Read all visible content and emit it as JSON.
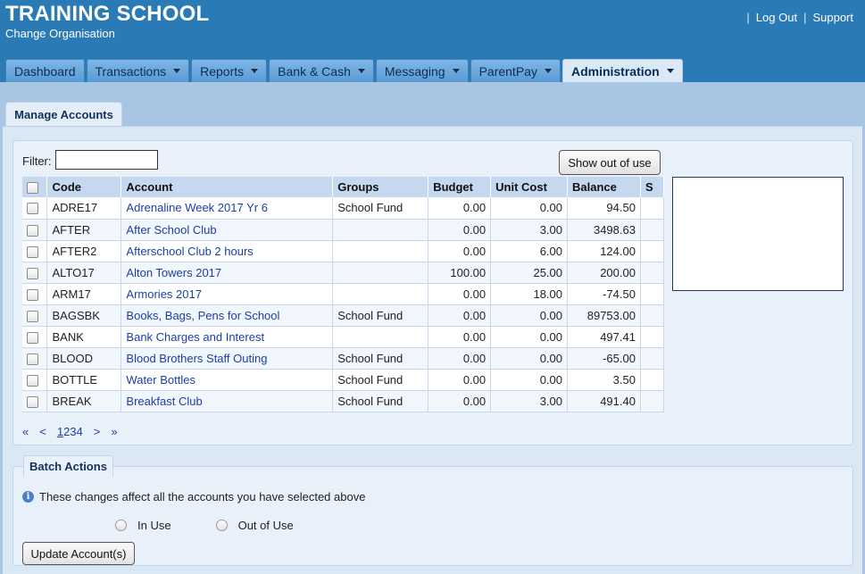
{
  "header": {
    "school_name": "TRAINING SCHOOL",
    "change_org": "Change Organisation",
    "sep": "|",
    "log_out": "Log Out",
    "support": "Support"
  },
  "nav": {
    "tabs": [
      {
        "label": "Dashboard"
      },
      {
        "label": "Transactions"
      },
      {
        "label": "Reports"
      },
      {
        "label": "Bank & Cash"
      },
      {
        "label": "Messaging"
      },
      {
        "label": "ParentPay"
      },
      {
        "label": "Administration"
      }
    ]
  },
  "page": {
    "subtab": "Manage Accounts",
    "filter_label": "Filter:",
    "filter_value": "",
    "show_out_of_use": "Show out of use"
  },
  "table": {
    "headers": {
      "code": "Code",
      "account": "Account",
      "groups": "Groups",
      "budget": "Budget",
      "unit_cost": "Unit Cost",
      "balance": "Balance",
      "s": "S"
    },
    "rows": [
      {
        "code": "ADRE17",
        "account": "Adrenaline Week 2017 Yr 6",
        "groups": "School Fund",
        "budget": "0.00",
        "unit_cost": "0.00",
        "balance": "94.50"
      },
      {
        "code": "AFTER",
        "account": "After School Club",
        "groups": "",
        "budget": "0.00",
        "unit_cost": "3.00",
        "balance": "3498.63"
      },
      {
        "code": "AFTER2",
        "account": "Afterschool Club 2 hours",
        "groups": "",
        "budget": "0.00",
        "unit_cost": "6.00",
        "balance": "124.00"
      },
      {
        "code": "ALTO17",
        "account": "Alton Towers 2017",
        "groups": "",
        "budget": "100.00",
        "unit_cost": "25.00",
        "balance": "200.00"
      },
      {
        "code": "ARM17",
        "account": "Armories 2017",
        "groups": "",
        "budget": "0.00",
        "unit_cost": "18.00",
        "balance": "-74.50"
      },
      {
        "code": "BAGSBK",
        "account": "Books, Bags, Pens for School",
        "groups": "School Fund",
        "budget": "0.00",
        "unit_cost": "0.00",
        "balance": "89753.00"
      },
      {
        "code": "BANK",
        "account": "Bank Charges and Interest",
        "groups": "",
        "budget": "0.00",
        "unit_cost": "0.00",
        "balance": "497.41"
      },
      {
        "code": "BLOOD",
        "account": "Blood Brothers Staff Outing",
        "groups": "School Fund",
        "budget": "0.00",
        "unit_cost": "0.00",
        "balance": "-65.00"
      },
      {
        "code": "BOTTLE",
        "account": "Water Bottles",
        "groups": "School Fund",
        "budget": "0.00",
        "unit_cost": "0.00",
        "balance": "3.50"
      },
      {
        "code": "BREAK",
        "account": "Breakfast Club",
        "groups": "School Fund",
        "budget": "0.00",
        "unit_cost": "3.00",
        "balance": "491.40"
      }
    ]
  },
  "pager": {
    "first": "«",
    "prev": "<",
    "pages": [
      "1",
      "2",
      "3",
      "4"
    ],
    "current": "1",
    "next": ">",
    "last": "»"
  },
  "batch": {
    "legend": "Batch Actions",
    "info": "These changes affect all the accounts you have selected above",
    "info_icon_glyph": "i",
    "in_use": "In Use",
    "out_of_use": "Out of Use",
    "update_button": "Update Account(s)"
  },
  "colors": {
    "header_bg": "#2a7ab6",
    "page_bg": "#a9c5e4",
    "link": "#1b3fa6",
    "table_header_bg": "#c6d8f0"
  }
}
